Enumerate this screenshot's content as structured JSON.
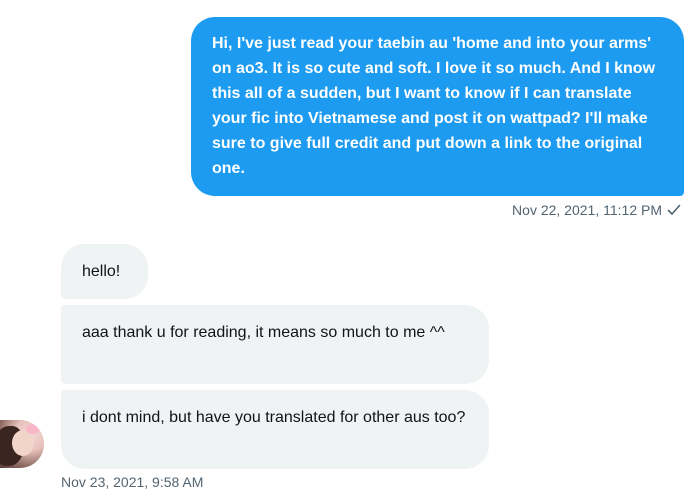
{
  "conversation": {
    "sent_message": {
      "text": "Hi, I've just read your taebin au 'home and into your arms' on ao3. It is so cute and soft. I love it so much. And I know this all of a sudden, but I want to know if I can translate your fic into Vietnamese and post it on wattpad? I'll make sure to give full credit and put down a link to the original one.",
      "timestamp": "Nov 22, 2021, 11:12 PM",
      "status_icon": "checkmark-icon",
      "color": "#1d9bf0"
    },
    "received_messages": [
      {
        "text": "hello!"
      },
      {
        "text": "aaa thank u for reading, it means so much to me ^^"
      },
      {
        "text": "i dont mind, but have you translated for other aus too?"
      }
    ],
    "received_timestamp": "Nov 23, 2021, 9:58 AM",
    "received_bubble_color": "#eff3f4"
  }
}
